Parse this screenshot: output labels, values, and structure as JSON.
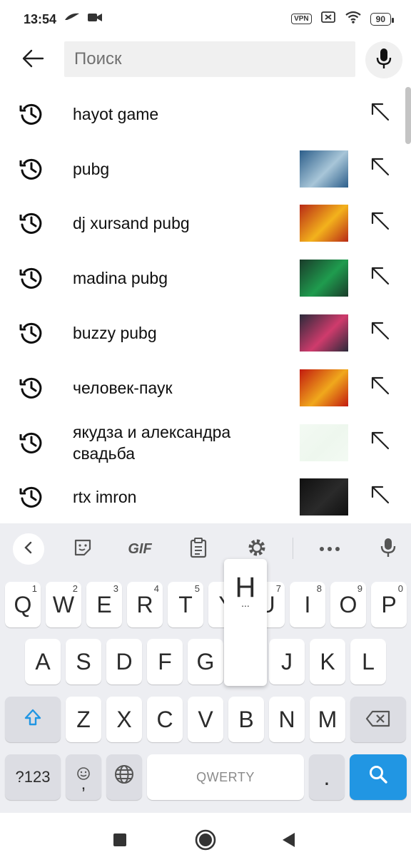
{
  "status_bar": {
    "time": "13:54",
    "vpn": "VPN",
    "battery": "90",
    "icons": [
      "sailboat-icon",
      "video-camera-icon",
      "vpn-badge",
      "sim-off-icon",
      "wifi-icon",
      "battery-icon"
    ]
  },
  "search": {
    "placeholder": "Поиск",
    "value": "",
    "back_icon": "arrow-left-icon",
    "mic_icon": "microphone-icon"
  },
  "suggestions": [
    {
      "text": "hayot game",
      "thumbnail": false,
      "icon": "history-icon",
      "action_icon": "arrow-up-left-icon"
    },
    {
      "text": "pubg",
      "thumbnail": true,
      "thumb_colors": [
        "#2c5e8a",
        "#a8c6d8"
      ],
      "icon": "history-icon",
      "action_icon": "arrow-up-left-icon"
    },
    {
      "text": "dj xursand pubg",
      "thumbnail": true,
      "thumb_colors": [
        "#b82a16",
        "#f3b21c"
      ],
      "icon": "history-icon",
      "action_icon": "arrow-up-left-icon"
    },
    {
      "text": "madina pubg",
      "thumbnail": true,
      "thumb_colors": [
        "#1a3b2a",
        "#1f9c4e"
      ],
      "icon": "history-icon",
      "action_icon": "arrow-up-left-icon"
    },
    {
      "text": "buzzy pubg",
      "thumbnail": true,
      "thumb_colors": [
        "#2a2a3a",
        "#cf3b6c"
      ],
      "icon": "history-icon",
      "action_icon": "arrow-up-left-icon"
    },
    {
      "text": "человек-паук",
      "thumbnail": true,
      "thumb_colors": [
        "#c21a0f",
        "#f0a81c"
      ],
      "icon": "history-icon",
      "action_icon": "arrow-up-left-icon"
    },
    {
      "text": "якудза и александра свадьба",
      "thumbnail": true,
      "thumb_colors": [
        "#f3faf3",
        "#eef7ee"
      ],
      "icon": "history-icon",
      "action_icon": "arrow-up-left-icon"
    },
    {
      "text": "rtx imron",
      "thumbnail": true,
      "thumb_colors": [
        "#101010",
        "#2a2a2a"
      ],
      "icon": "history-icon",
      "action_icon": "arrow-up-left-icon"
    }
  ],
  "keyboard": {
    "toolbar": [
      "chevron-left-icon",
      "sticker-icon",
      "gif-label",
      "clipboard-icon",
      "gear-icon",
      "more-dots-icon",
      "microphone-icon"
    ],
    "gif_label": "GIF",
    "row1": [
      {
        "label": "Q",
        "hint": "1"
      },
      {
        "label": "W",
        "hint": "2"
      },
      {
        "label": "E",
        "hint": "3"
      },
      {
        "label": "R",
        "hint": "4"
      },
      {
        "label": "T",
        "hint": "5"
      },
      {
        "label": "Y",
        "hint": "6"
      },
      {
        "label": "U",
        "hint": "7"
      },
      {
        "label": "I",
        "hint": "8"
      },
      {
        "label": "O",
        "hint": "9"
      },
      {
        "label": "P",
        "hint": "0"
      }
    ],
    "row2": [
      "A",
      "S",
      "D",
      "F",
      "G",
      "H",
      "J",
      "K",
      "L"
    ],
    "row3": [
      "Z",
      "X",
      "C",
      "V",
      "B",
      "N",
      "M"
    ],
    "numbers_label": "?123",
    "comma_label": ",",
    "space_label": "QWERTY",
    "period_label": ".",
    "popup_letter": "H",
    "popup_dots": "...",
    "accent_color": "#2196e3"
  },
  "navbar": [
    "recents-square-icon",
    "home-circle-icon",
    "back-triangle-icon"
  ]
}
